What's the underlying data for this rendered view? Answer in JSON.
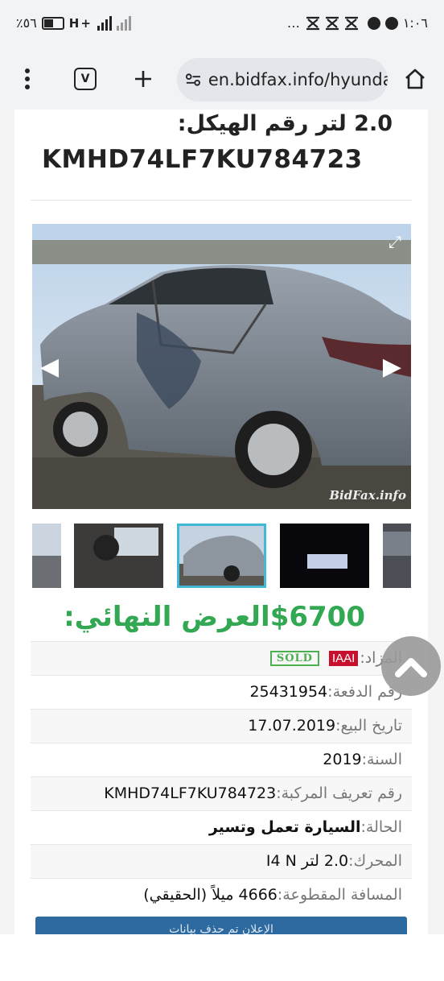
{
  "status_bar": {
    "battery_percent": "٪٥٦",
    "network_label": "H+",
    "clock": "١:٠٦",
    "more_icon": "…"
  },
  "browser": {
    "url": "en.bidfax.info/hyundai",
    "icons": [
      "menu-dots-icon",
      "vpn-icon",
      "plus-icon",
      "site-settings-icon",
      "home-icon"
    ]
  },
  "listing": {
    "title_line1": "2.0 لتر رقم الهيكل:",
    "title_line2": "KMHD74LF7KU784723",
    "photo_watermark": "BidFax.info",
    "final_offer_label": "العرض النهائي:",
    "final_offer_value": "$6700",
    "details": {
      "auction": {
        "label": "المزاد:",
        "badge": "IAAI",
        "status": "SOLD"
      },
      "lot": {
        "label": "رقم الدفعة:",
        "value": "25431954"
      },
      "sale_date": {
        "label": "تاريخ البيع:",
        "value": "17.07.2019"
      },
      "year": {
        "label": "السنة:",
        "value": "2019"
      },
      "vin": {
        "label": "رقم تعريف المركبة:",
        "value": "KMHD74LF7KU784723"
      },
      "condition": {
        "label": "الحالة:",
        "value": "السيارة تعمل وتسير"
      },
      "engine": {
        "label": "المحرك:",
        "value": "2.0 لتر I4 N"
      },
      "mileage": {
        "label": "المسافة المقطوعة:",
        "value": "4666 ميلاً (الحقيقي)"
      }
    },
    "insurance_bar": "الإعلان تم حذف بيانات"
  },
  "colors": {
    "offer_green": "#33a852",
    "iaai_red": "#c8102e",
    "sold_green": "#4caf50",
    "thumb_highlight": "#41b8d6",
    "insurance_blue": "#2c6aa0"
  }
}
